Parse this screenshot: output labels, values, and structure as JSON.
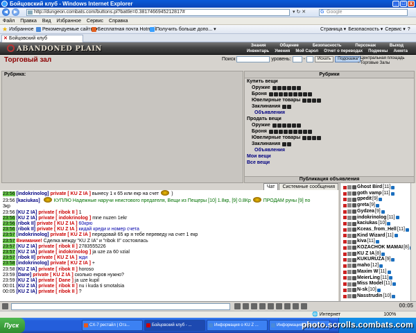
{
  "window": {
    "title": "Бойцовский клуб - Windows Internet Explorer",
    "minimize": "_",
    "maximize": "□",
    "close": "x",
    "back": "◀",
    "forward": "▶"
  },
  "address_bar": {
    "url": "http://dungeon.combats.com/buttons.pl?battle=0.3817466945212817#",
    "tools": "▾ ↻ ✕",
    "search_placeholder": "Google",
    "search_brand": "G"
  },
  "menu": [
    "Файл",
    "Правка",
    "Вид",
    "Избранное",
    "Сервис",
    "Справка"
  ],
  "favorites": {
    "label": "Избранное",
    "star": "★",
    "items": [
      {
        "label": "Рекомендуемые сайты ▾",
        "color": "#4a8ad8"
      },
      {
        "label": "Бесплатная почта Hotmail",
        "color": "#e06020"
      },
      {
        "label": "Получить больше допо... ▾",
        "color": "#3aa0ff"
      }
    ],
    "right": [
      "Страница ▾",
      "Безопасность ▾",
      "Сервис ▾",
      "?"
    ]
  },
  "tab": {
    "label": "Бойцовский клуб",
    "close": "✕"
  },
  "game": {
    "logo": "ABANDONED PLAIN",
    "nav_row1": [
      "Знания",
      "Общение",
      "Безопасность",
      "Персонаж",
      "Выход"
    ],
    "nav_row2": [
      "Инвентарь",
      "Умения",
      "Мой Сарол",
      "Отчет о переводах",
      "Подмены",
      "Анкета"
    ]
  },
  "page": {
    "title": "Торговый зал",
    "search_label": "Поиск",
    "level_label": "уровень:",
    "level_dash": "-",
    "search_button": "Искать",
    "hint_button": "Подсказка",
    "locations": [
      "Центральная площадь",
      "Торговые Залы"
    ]
  },
  "rubrics": {
    "left_header": "Рубрика:",
    "right_header": "Рубрики",
    "buy": {
      "title": "Купить вещи",
      "subs": [
        {
          "label": "Оружие",
          "icons": 6
        },
        {
          "label": "Броня",
          "icons": 9
        },
        {
          "label": "Ювелирные товары",
          "icons": 4
        },
        {
          "label": "Заклинания",
          "icons": 2
        }
      ],
      "announcements": "Объявления"
    },
    "sell": {
      "title": "Продать вещи",
      "subs": [
        {
          "label": "Оружие",
          "icons": 6
        },
        {
          "label": "Броня",
          "icons": 9
        },
        {
          "label": "Ювелирные товары",
          "icons": 4
        },
        {
          "label": "Заклинания",
          "icons": 2
        }
      ],
      "announcements": "Объявления"
    },
    "links": [
      "Мои вещи",
      "Все вещи"
    ],
    "publish": "Публикация объявления"
  },
  "chat_tabs": [
    "Чат",
    "Системные сообщения"
  ],
  "chat": [
    {
      "time": "23:56",
      "green": true,
      "nick": "[indokrinolog]",
      "priv": "private [ KU Z IA ]",
      "text": "вынесу 1 к 65 или екр на счет",
      "bee": true,
      "tail": ")"
    },
    {
      "time": "23:56",
      "green": false,
      "nick": "[kaciukas]",
      "trade": true,
      "bee": true,
      "text": "КУПЛЮ Надежные наручи неистового предателя, Вещи из Пещеры [10] 1.8кр, [9] 0.8Кр",
      "bee2": true,
      "text2": "ПРОДАМ руны [9] по"
    },
    {
      "time": "",
      "green": false,
      "nick": "",
      "text": "3кр"
    },
    {
      "time": "23:56",
      "green": false,
      "nick": "[KU Z IA]",
      "priv": "private [ ribok II ]",
      "text": "1"
    },
    {
      "time": "23:56",
      "green": true,
      "nick": "[KU Z IA]",
      "priv": "private [ indokrinolog ]",
      "text": "mne nuzen 1ekr"
    },
    {
      "time": "23:56",
      "green": true,
      "nick": "[ribok II]",
      "priv": "private [ KU Z IA ]",
      "text": "60крю",
      "blue": true
    },
    {
      "time": "23:56",
      "green": true,
      "nick": "[ribok II]",
      "priv": "private [ KU Z IA ]",
      "text": "кидай креди и номер счета",
      "blue": true
    },
    {
      "time": "23:57",
      "green": true,
      "nick": "[indokrinolog]",
      "priv": "private [ KU Z IA ]",
      "text": "передовай 65 кр я тебе переведу на счет 1 екр"
    },
    {
      "time": "23:57",
      "green": true,
      "nick": "",
      "warn": "Внимание!",
      "text": "Сделка между \"KU Z IA\" и \"ribok II\" состоялась"
    },
    {
      "time": "23:57",
      "green": true,
      "nick": "[KU Z IA]",
      "priv": "private [ ribok II ]",
      "text": "2783555226"
    },
    {
      "time": "23:57",
      "green": true,
      "nick": "[KU Z IA]",
      "priv": "private [ indokrinolog ]",
      "text": "ja uze za 60 vzial"
    },
    {
      "time": "23:57",
      "green": true,
      "nick": "[ribok II]",
      "priv": "private [ KU Z IA ]",
      "text": "жди",
      "blue": true
    },
    {
      "time": "23:58",
      "green": true,
      "nick": "[indokrinolog]",
      "priv": "private [ KU Z IA ]",
      "text": "+"
    },
    {
      "time": "23:58",
      "green": false,
      "nick": "[KU Z IA]",
      "priv": "private [ ribok II ]",
      "text": "horoso"
    },
    {
      "time": "23:59",
      "green": false,
      "nick": "[Dane]",
      "priv": "private [ KU Z IA ]",
      "text": "сколько екров нужно?"
    },
    {
      "time": "23:59",
      "green": false,
      "nick": "[KU Z IA]",
      "priv": "private [ Dane ]",
      "text": "ja uze kupil"
    },
    {
      "time": "00:01",
      "green": false,
      "nick": "[KU Z IA]",
      "priv": "private [ ribok II ]",
      "text": "nu i kuda ti smotalsia"
    },
    {
      "time": "00:05",
      "green": false,
      "nick": "[KU Z IA]",
      "priv": "private [ ribok II ]",
      "text": "?"
    }
  ],
  "users": [
    {
      "name": "Ghost Bird",
      "level": "[11]"
    },
    {
      "name": "goth vamp",
      "level": "[11]"
    },
    {
      "name": "gpedit",
      "level": "[9]"
    },
    {
      "name": "greta",
      "level": "[9]"
    },
    {
      "name": "Gydzea",
      "level": "[9]"
    },
    {
      "name": "indokrinolog",
      "level": "[11]"
    },
    {
      "name": "kaciukas",
      "level": "[10]"
    },
    {
      "name": "Kceas_from_Hell",
      "level": "[11]"
    },
    {
      "name": "Kind Wizard",
      "level": "[11]"
    },
    {
      "name": "kiva",
      "level": "[11]"
    },
    {
      "name": "KOZACHOK MAMAI",
      "level": "[8]"
    },
    {
      "name": "KU Z IA",
      "level": "[8]"
    },
    {
      "name": "KUKURUZA",
      "level": "[9]"
    },
    {
      "name": "maho",
      "level": "[12]"
    },
    {
      "name": "Maxim W",
      "level": "[11]"
    },
    {
      "name": "MeierLing",
      "level": "[11]"
    },
    {
      "name": "Miss Model",
      "level": "[11]"
    },
    {
      "name": "N-sk",
      "level": "[10]"
    },
    {
      "name": "Nasstrudin",
      "level": "[10]"
    }
  ],
  "input_bar": {
    "clock": "00:05"
  },
  "status": {
    "zone": "Интернет",
    "zoom": "100%"
  },
  "taskbar": {
    "start": "Пуск",
    "buttons": [
      {
        "label": "CX-7 рестайл | Отз...",
        "color": "#e85a1c"
      },
      {
        "label": "Бойцовский клуб - ...",
        "color": "#c00",
        "active": true
      },
      {
        "label": "Информация о KU Z ...",
        "color": "#4a8ad8"
      },
      {
        "label": "Информация о иван...",
        "color": "#4a8ad8"
      }
    ],
    "watermark": "photo.scrolls.combats.com"
  }
}
